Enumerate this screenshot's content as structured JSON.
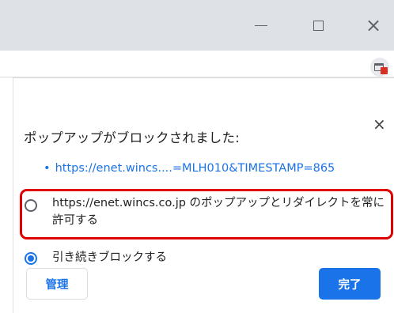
{
  "window": {
    "minimize_icon": "minimize-icon",
    "maximize_icon": "maximize-icon",
    "close_glyph": "×"
  },
  "toolbar": {
    "popup_blocked_icon": "popup-blocked-icon"
  },
  "bubble": {
    "title": "ポップアップがブロックされました:",
    "close_glyph": "×",
    "blocked_link": "https://enet.wincs....=MLH010&TIMESTAMP=865",
    "options": [
      {
        "label": "https://enet.wincs.co.jp のポップアップとリダイレクトを常に許可する",
        "selected": false
      },
      {
        "label": "引き続きブロックする",
        "selected": true
      }
    ],
    "manage_label": "管理",
    "done_label": "完了"
  },
  "colors": {
    "accent": "#1a73e8",
    "highlight": "#e00000",
    "titlebar": "#dee1e6"
  }
}
